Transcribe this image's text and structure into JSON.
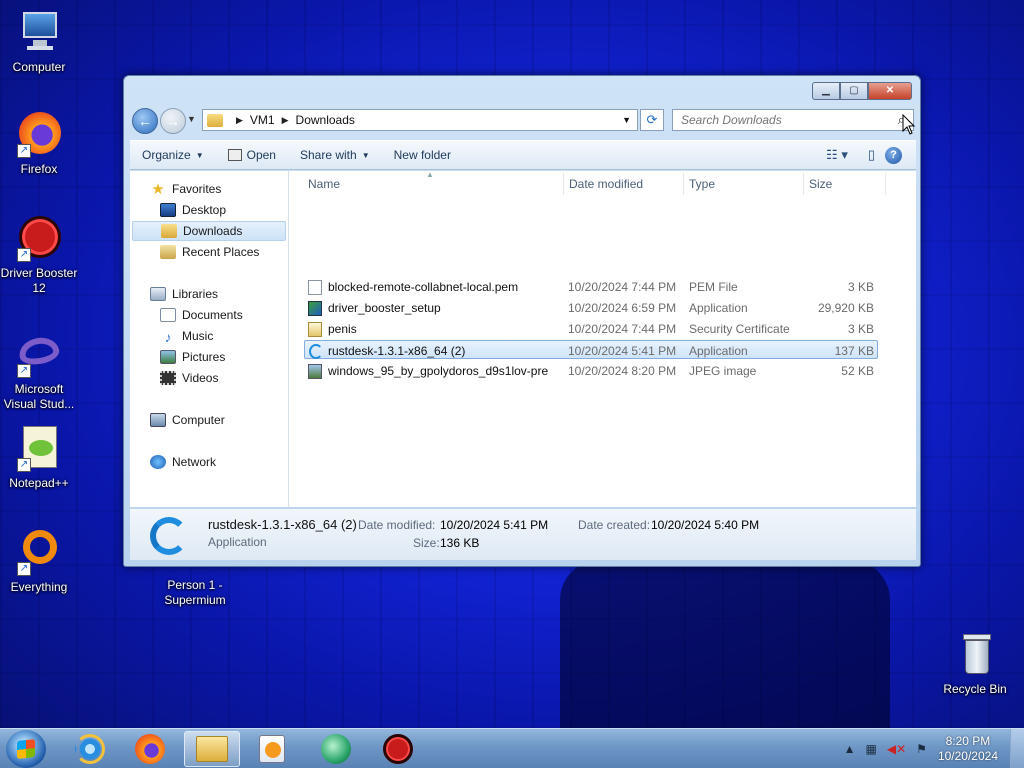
{
  "desktop": {
    "icons": [
      {
        "label": "Computer",
        "icon": "computer-icon"
      },
      {
        "label": "Firefox",
        "icon": "firefox-icon"
      },
      {
        "label": "Driver Booster 12",
        "icon": "driver-booster-icon"
      },
      {
        "label": "Microsoft Visual Stud...",
        "icon": "visual-studio-icon"
      },
      {
        "label": "Notepad++",
        "icon": "notepadpp-icon"
      },
      {
        "label": "Everything",
        "icon": "everything-icon"
      },
      {
        "label": "Person 1 - Supermium",
        "icon": "supermium-icon"
      },
      {
        "label": "Recycle Bin",
        "icon": "recycle-bin-icon"
      }
    ]
  },
  "window": {
    "breadcrumb": [
      "VM1",
      "Downloads"
    ],
    "search_placeholder": "Search Downloads",
    "toolbar": {
      "organize": "Organize",
      "open": "Open",
      "share_with": "Share with",
      "new_folder": "New folder"
    },
    "nav": {
      "favorites": "Favorites",
      "desktop": "Desktop",
      "downloads": "Downloads",
      "recent_places": "Recent Places",
      "libraries": "Libraries",
      "documents": "Documents",
      "music": "Music",
      "pictures": "Pictures",
      "videos": "Videos",
      "computer": "Computer",
      "network": "Network"
    },
    "columns": {
      "name": "Name",
      "date_modified": "Date modified",
      "type": "Type",
      "size": "Size"
    },
    "files": [
      {
        "name": "blocked-remote-collabnet-local.pem",
        "date": "10/20/2024 7:44 PM",
        "type": "PEM File",
        "size": "3 KB",
        "icon": "pem-file-icon"
      },
      {
        "name": "driver_booster_setup",
        "date": "10/20/2024 6:59 PM",
        "type": "Application",
        "size": "29,920 KB",
        "icon": "installer-icon"
      },
      {
        "name": "penis",
        "date": "10/20/2024 7:44 PM",
        "type": "Security Certificate",
        "size": "3 KB",
        "icon": "certificate-icon"
      },
      {
        "name": "rustdesk-1.3.1-x86_64 (2)",
        "date": "10/20/2024 5:41 PM",
        "type": "Application",
        "size": "137 KB",
        "icon": "rustdesk-icon"
      },
      {
        "name": "windows_95_by_gpolydoros_d9s1lov-pre",
        "date": "10/20/2024 8:20 PM",
        "type": "JPEG image",
        "size": "52 KB",
        "icon": "jpeg-icon"
      }
    ],
    "selected_index": 3,
    "details": {
      "name": "rustdesk-1.3.1-x86_64 (2)",
      "type": "Application",
      "date_modified_label": "Date modified:",
      "date_modified": "10/20/2024 5:41 PM",
      "date_created_label": "Date created:",
      "date_created": "10/20/2024 5:40 PM",
      "size_label": "Size:",
      "size": "136 KB"
    }
  },
  "taskbar": {
    "time": "8:20 PM",
    "date": "10/20/2024"
  },
  "colors": {
    "desktop_bg": "#1224d8",
    "selection": "#cfe4f9",
    "rustdesk_blue": "#1e8de0"
  }
}
